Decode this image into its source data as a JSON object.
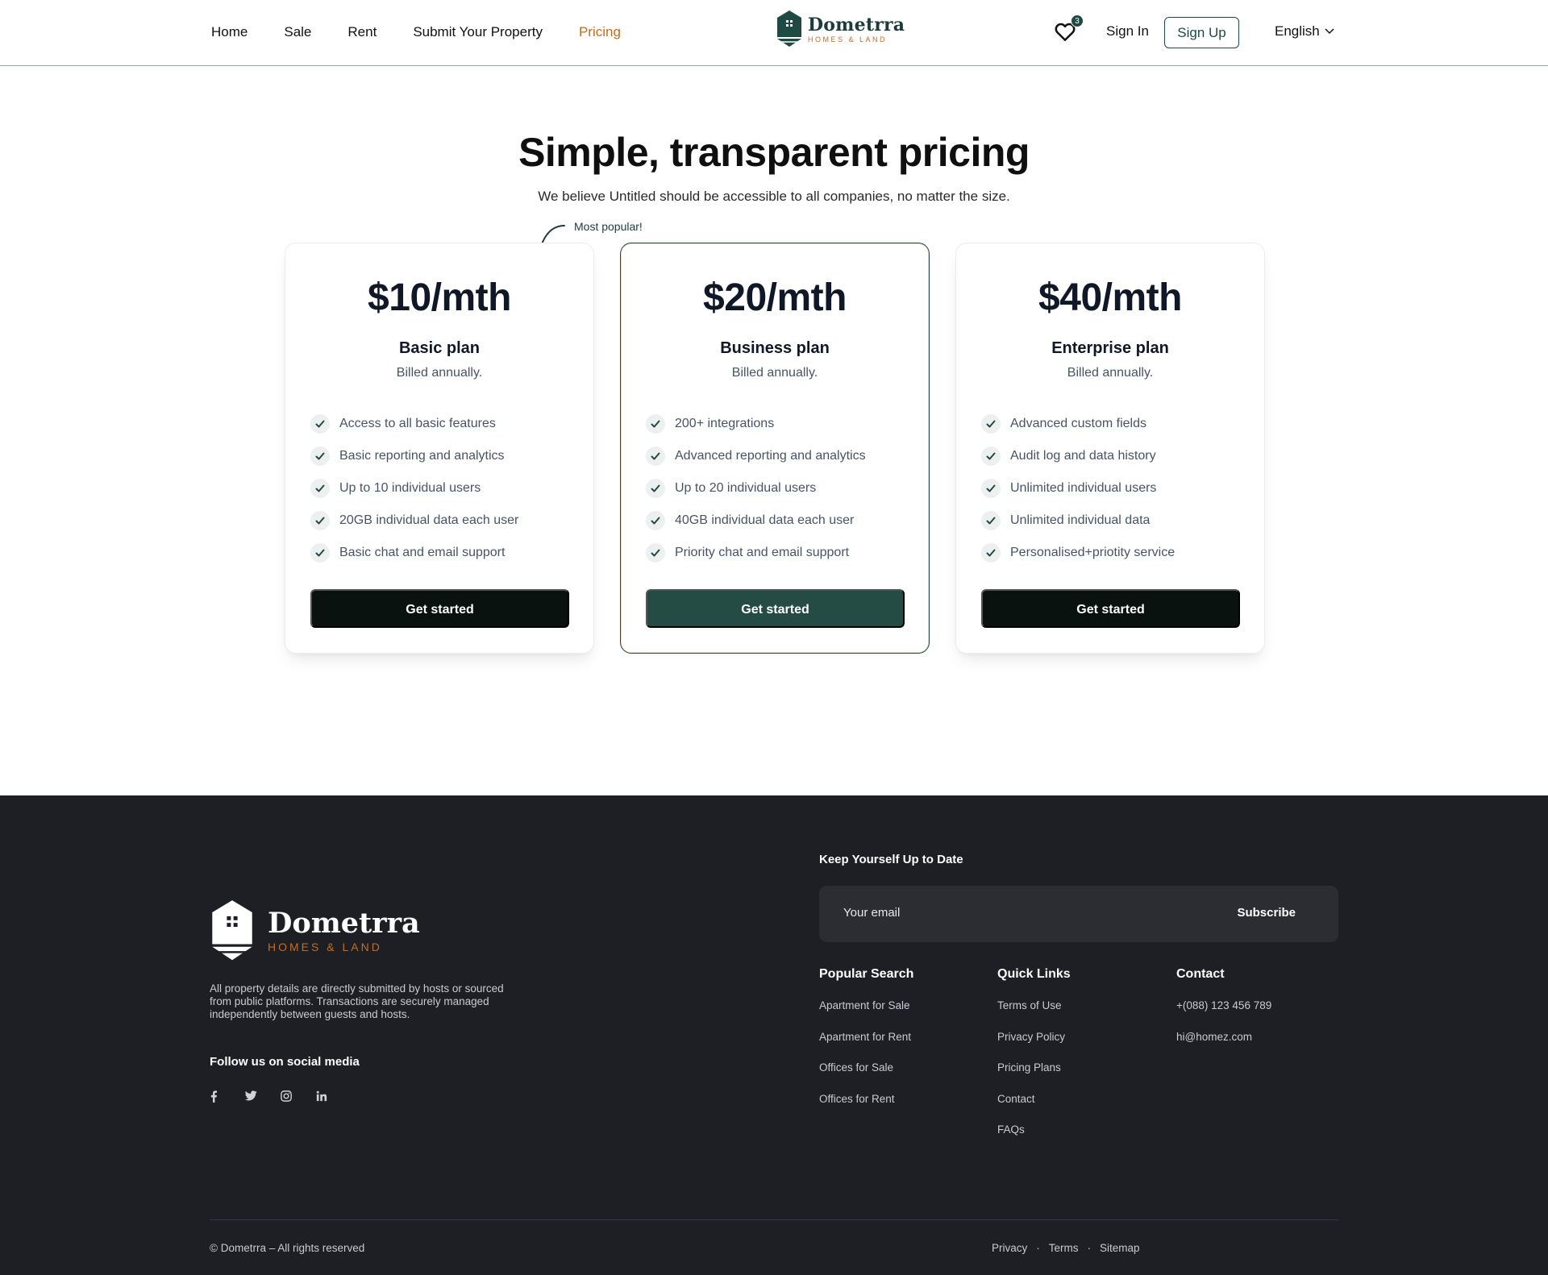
{
  "header": {
    "nav": [
      "Home",
      "Sale",
      "Rent",
      "Submit Your Property",
      "Pricing"
    ],
    "active_nav": "Pricing",
    "brand": {
      "name": "Dometrra",
      "tagline": "HOMES & LAND"
    },
    "favorites_count": "3",
    "sign_in": "Sign In",
    "sign_up": "Sign Up",
    "language": "English",
    "icons": [
      "heart-icon",
      "chevron-down-icon"
    ]
  },
  "hero": {
    "title": "Simple, transparent pricing",
    "subtitle": "We believe Untitled should be accessible to all companies, no matter the size.",
    "popular_note": "Most popular!"
  },
  "plans": [
    {
      "price": "$10/mth",
      "name": "Basic plan",
      "billing": "Billed annually.",
      "features": [
        "Access to all basic features",
        "Basic reporting and analytics",
        "Up to 10 individual users",
        "20GB individual data each user",
        "Basic chat and email support"
      ],
      "cta": "Get started"
    },
    {
      "price": "$20/mth",
      "name": "Business plan",
      "billing": "Billed annually.",
      "features": [
        "200+ integrations",
        "Advanced reporting and analytics",
        "Up to 20 individual users",
        "40GB individual data each user",
        "Priority chat and email support"
      ],
      "cta": "Get started"
    },
    {
      "price": "$40/mth",
      "name": "Enterprise plan",
      "billing": "Billed annually.",
      "features": [
        "Advanced custom fields",
        "Audit log and data history",
        "Unlimited individual users",
        "Unlimited individual data",
        "Personalised+priotity service"
      ],
      "cta": "Get started"
    }
  ],
  "colors": {
    "brand_dark": "#1f4a44",
    "accent": "#c56d1e",
    "footer_bg": "#1d1f25",
    "cta_dark": "#0a1210"
  },
  "footer": {
    "brand": {
      "name": "Dometrra",
      "tagline": "HOMES & LAND"
    },
    "description": "All property details are directly submitted by hosts or sourced from public platforms. Transactions are securely managed independently between guests and hosts.",
    "follow": "Follow us on social media",
    "social": [
      "facebook-icon",
      "twitter-icon",
      "instagram-icon",
      "linkedin-icon"
    ],
    "newsletter": {
      "title": "Keep Yourself Up to Date",
      "placeholder": "Your email",
      "button": "Subscribe"
    },
    "columns": [
      {
        "heading": "Popular Search",
        "links": [
          "Apartment for Sale",
          "Apartment for Rent",
          "Offices for Sale",
          "Offices for Rent"
        ]
      },
      {
        "heading": "Quick Links",
        "links": [
          "Terms of Use",
          "Privacy Policy",
          "Pricing Plans",
          "Contact",
          "FAQs"
        ]
      },
      {
        "heading": "Contact",
        "links": [
          "+(088) 123 456 789",
          "hi@homez.com"
        ]
      }
    ],
    "copyright": "© Dometrra – All rights reserved",
    "legal": [
      "Privacy",
      "Terms",
      "Sitemap"
    ]
  }
}
